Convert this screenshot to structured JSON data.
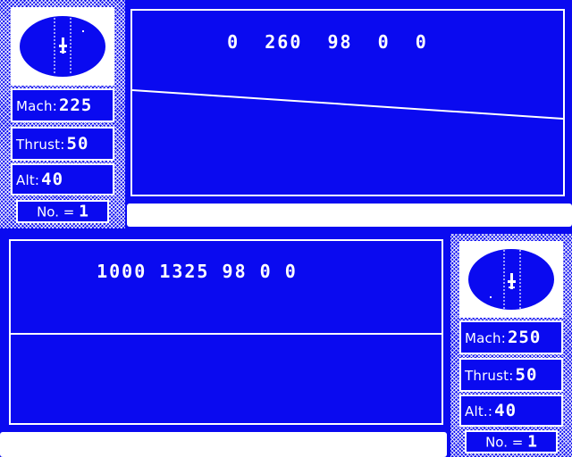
{
  "players": [
    {
      "id": "p1",
      "status_values": [
        "0",
        "260",
        "98",
        "0",
        "0"
      ],
      "mach": {
        "label": "Mach:",
        "value": "225"
      },
      "thrust": {
        "label": "Thrust:",
        "value": "50"
      },
      "alt": {
        "label": "Alt:",
        "value": "40"
      },
      "count": {
        "label": "No. =",
        "value": "1"
      },
      "radar": {
        "icon": "aircraft-icon"
      }
    },
    {
      "id": "p2",
      "status_values": [
        "1000",
        "1325",
        "98",
        "0",
        "0"
      ],
      "mach": {
        "label": "Mach:",
        "value": "250"
      },
      "thrust": {
        "label": "Thrust:",
        "value": "50"
      },
      "alt": {
        "label": "Alt.:",
        "value": "40"
      },
      "count": {
        "label": "No. =",
        "value": "1"
      },
      "radar": {
        "icon": "aircraft-icon"
      }
    }
  ],
  "colors": {
    "background": "#0a0af0",
    "foreground": "#ffffff"
  }
}
